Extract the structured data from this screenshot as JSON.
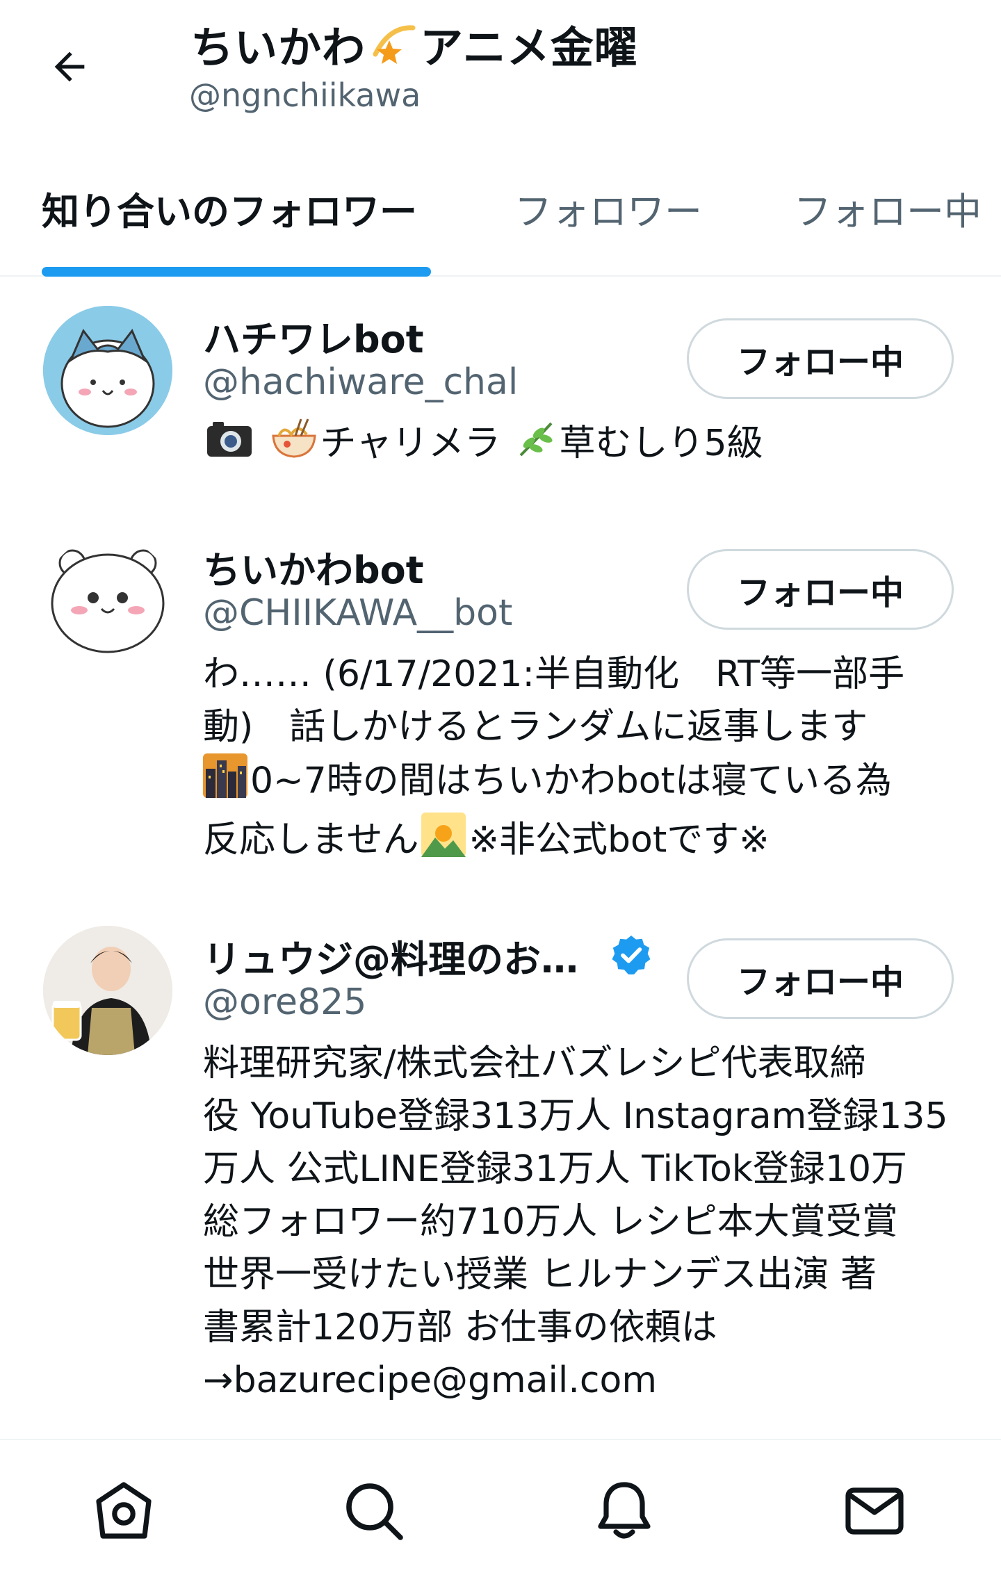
{
  "header": {
    "title_part1": "ちいかわ",
    "title_part2": "アニメ金曜",
    "handle": "@ngnchiikawa",
    "back_icon": "arrow-left-icon"
  },
  "tabs": [
    {
      "label": "知り合いのフォロワー",
      "active": true
    },
    {
      "label": "フォロワー",
      "active": false
    },
    {
      "label": "フォロー中",
      "active": false
    }
  ],
  "accent_color": "#1d9bf0",
  "users": [
    {
      "name": "ハチワレbot",
      "handle": "@hachiware_chal",
      "bio_part1": "チャリメラ",
      "bio_part2": "草むしり5級",
      "button": "フォロー中"
    },
    {
      "name": "ちいかわbot",
      "handle": "@CHIIKAWA__bot",
      "bio_line1": "わ…… (6/17/2021:半自動化　RT等一部手",
      "bio_line2": "動)　話しかけるとランダムに返事します",
      "bio_line3": "0~7時の間はちいかわbotは寝ている為",
      "bio_line4a": "反応しません",
      "bio_line4b": "※非公式botです※",
      "button": "フォロー中"
    },
    {
      "name": "リュウジ@料理のお…",
      "verified": true,
      "handle": "@ore825",
      "bio_lines": [
        "料理研究家/株式会社バズレシピ代表取締",
        "役 YouTube登録313万人 Instagram登録135",
        "万人 公式LINE登録31万人 TikTok登録10万",
        "総フォロワー約710万人 レシピ本大賞受賞",
        "世界一受けたい授業 ヒルナンデス出演 著",
        "書累計120万部 お仕事の依頼は",
        "→bazurecipe@gmail.com"
      ],
      "button": "フォロー中"
    }
  ],
  "bottom_nav": [
    "home-icon",
    "search-icon",
    "bell-icon",
    "mail-icon"
  ]
}
